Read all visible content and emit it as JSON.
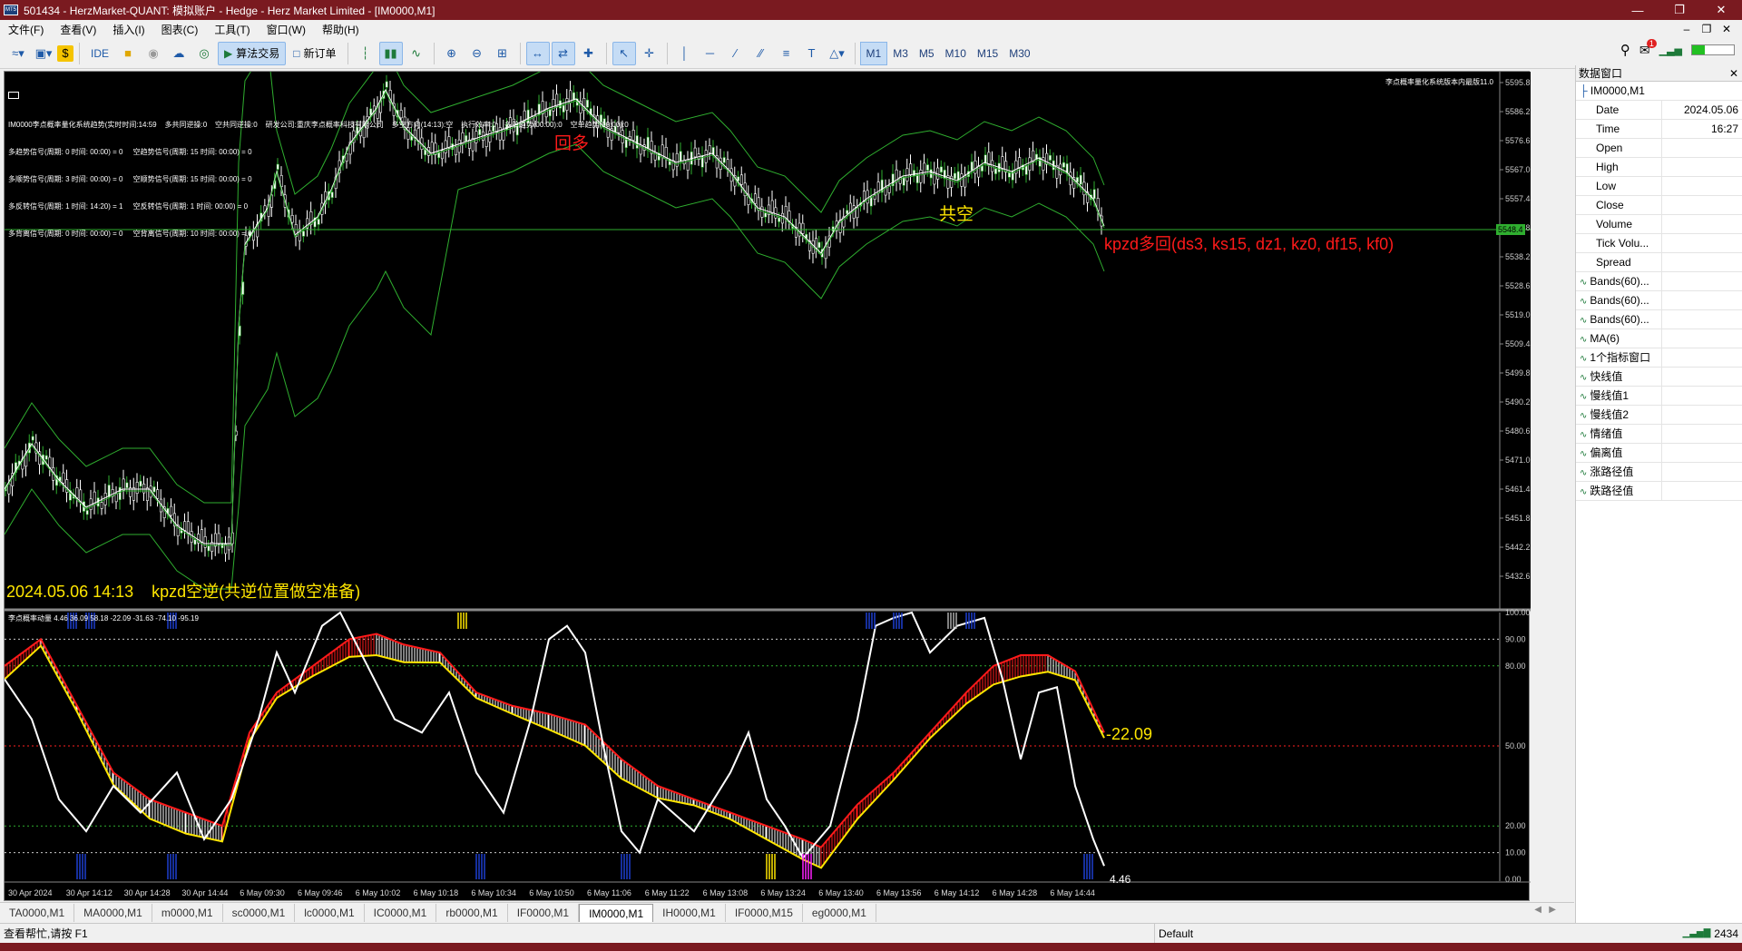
{
  "window": {
    "title": "501434 - HerzMarket-QUANT: 模拟账户 - Hedge - Herz Market Limited - [IM0000,M1]"
  },
  "menu": [
    "文件(F)",
    "查看(V)",
    "插入(I)",
    "图表(C)",
    "工具(T)",
    "窗口(W)",
    "帮助(H)"
  ],
  "toolbar": {
    "ide": "IDE",
    "algo": "算法交易",
    "neworder": "新订单",
    "timeframes": [
      "M1",
      "M3",
      "M5",
      "M10",
      "M15",
      "M30"
    ],
    "notif": "1"
  },
  "chart": {
    "yticks": [
      "5595.8",
      "5586.2",
      "5576.6",
      "5567.0",
      "5557.4",
      "5547.8",
      "5538.2",
      "5528.6",
      "5519.0",
      "5509.4",
      "5499.8",
      "5490.2",
      "5480.6",
      "5471.0",
      "5461.4",
      "5451.8",
      "5442.2",
      "5432.6"
    ],
    "price_tag": "5548.4",
    "sub_yticks": [
      "100.00",
      "90.00",
      "80.00",
      "50.00",
      "20.00",
      "10.00",
      "0.00"
    ],
    "xticks": [
      "30 Apr 2024",
      "30 Apr 14:12",
      "30 Apr 14:28",
      "30 Apr 14:44",
      "6 May 09:30",
      "6 May 09:46",
      "6 May 10:02",
      "6 May 10:18",
      "6 May 10:34",
      "6 May 10:50",
      "6 May 11:06",
      "6 May 11:22",
      "6 May 13:08",
      "6 May 13:24",
      "6 May 13:40",
      "6 May 13:56",
      "6 May 14:12",
      "6 May 14:28",
      "6 May 14:44"
    ],
    "info_lines": [
      "IM0000李点概率量化系统趋势(实时时间:14:59    多共同逆操:0    空共同逆操:0    研发公司:重庆李点概率科技有限公司    多空方向(14:13):空    执行效率:0    多单趋势(00:00):0    空单趋势(00:00):0",
      "多趋势信号(周期: 0 时间: 00:00) = 0     空趋势信号(周期: 15 时间: 00:00) = 0",
      "多顺势信号(周期: 3 时间: 00:00) = 0     空顺势信号(周期: 15 时间: 00:00) = 0",
      "多反转信号(周期: 1 时间: 14:20) = 1     空反转信号(周期: 1 时间: 00:00) = 0",
      "多背离信号(周期: 0 时间: 00:00) = 0     空背离信号(周期: 10 时间: 00:00) = 0"
    ],
    "version_label": "李点概率量化系统版本内最版11.0",
    "label_huiduo": "回多",
    "label_gongkong": "共空",
    "signal_text": "kpzd多回(ds3, ks15, dz1, kz0, df15, kf0)",
    "bottom_date": "2024.05.06 14:13",
    "bottom_text": "kpzd空逆(共逆位置做空准备)",
    "sub_title": "李点概率动量 4.46 36.09 58.18 -22.09 -31.63 -74.10 -95.19",
    "sub_value": "-22.09",
    "sub_value2": "4.46",
    "colors": {
      "bands": "#2fae2f",
      "ma": "#ffffff",
      "bull": "#ffffff",
      "bear": "#ff2020",
      "yellow": "#ffe600",
      "red": "#ff1a1a"
    }
  },
  "tabs": [
    "TA0000,M1",
    "MA0000,M1",
    "m0000,M1",
    "sc0000,M1",
    "lc0000,M1",
    "IC0000,M1",
    "rb0000,M1",
    "IF0000,M1",
    "IM0000,M1",
    "IH0000,M1",
    "IF0000,M15",
    "eg0000,M1"
  ],
  "active_tab": "IM0000,M1",
  "status": {
    "help": "查看帮忙,请按 F1",
    "profile": "Default",
    "conn": "2434"
  },
  "datawin": {
    "title": "数据窗口",
    "symbol": "IM0000,M1",
    "rows": [
      {
        "k": "Date",
        "v": "2024.05.06"
      },
      {
        "k": "Time",
        "v": "16:27"
      },
      {
        "k": "Open",
        "v": ""
      },
      {
        "k": "High",
        "v": ""
      },
      {
        "k": "Low",
        "v": ""
      },
      {
        "k": "Close",
        "v": ""
      },
      {
        "k": "Volume",
        "v": ""
      },
      {
        "k": "Tick Volu...",
        "v": ""
      },
      {
        "k": "Spread",
        "v": ""
      }
    ],
    "indicators": [
      "Bands(60)...",
      "Bands(60)...",
      "Bands(60)...",
      "MA(6)",
      "1个指标窗口",
      "快线值",
      "慢线值1",
      "慢线值2",
      "情绪值",
      "偏离值",
      "涨路径值",
      "跌路径值"
    ]
  }
}
